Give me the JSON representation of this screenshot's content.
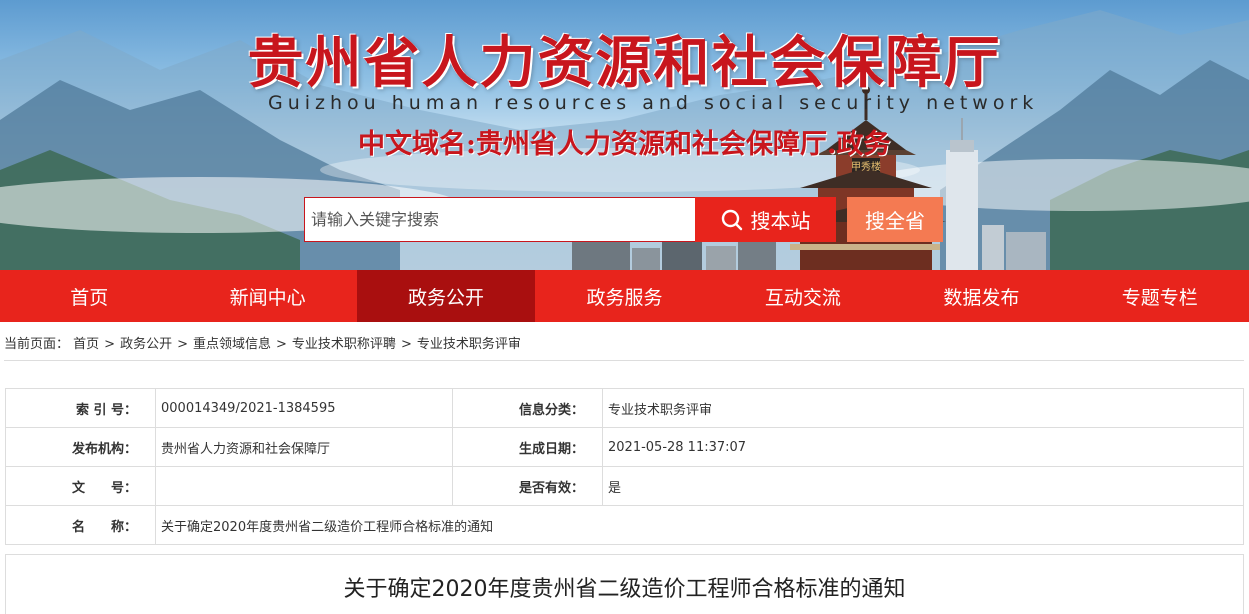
{
  "banner": {
    "title": "贵州省人力资源和社会保障厅",
    "subtitle": "Guizhou human resources and social security network",
    "domain": "中文域名:贵州省人力资源和社会保障厅.政务",
    "tower_sign": "甲秀楼"
  },
  "search": {
    "placeholder": "请输入关键字搜索",
    "site_button": "搜本站",
    "province_button": "搜全省"
  },
  "nav": {
    "items": [
      "首页",
      "新闻中心",
      "政务公开",
      "政务服务",
      "互动交流",
      "数据发布",
      "专题专栏"
    ],
    "active_index": 2
  },
  "breadcrumb": {
    "prefix": "当前页面：",
    "items": [
      "首页",
      "政务公开",
      "重点领域信息",
      "专业技术职称评聘",
      "专业技术职务评审"
    ],
    "separator": ">"
  },
  "info": {
    "index_label": "索 引 号：",
    "index_value": "000014349/2021-1384595",
    "category_label": "信息分类：",
    "category_value": "专业技术职务评审",
    "publisher_label": "发布机构：",
    "publisher_value": "贵州省人力资源和社会保障厅",
    "date_label": "生成日期：",
    "date_value": "2021-05-28 11:37:07",
    "doc_label": "文　　号：",
    "doc_value": "",
    "valid_label": "是否有效：",
    "valid_value": "是",
    "name_label": "名　　称：",
    "name_value": "关于确定2020年度贵州省二级造价工程师合格标准的通知"
  },
  "article": {
    "title": "关于确定2020年度贵州省二级造价工程师合格标准的通知"
  },
  "colors": {
    "brand_red": "#e8241c",
    "nav_active": "#a90f0f",
    "title_red": "#c8161d",
    "province_button": "#f47a52"
  },
  "icons": [
    "search-icon"
  ]
}
